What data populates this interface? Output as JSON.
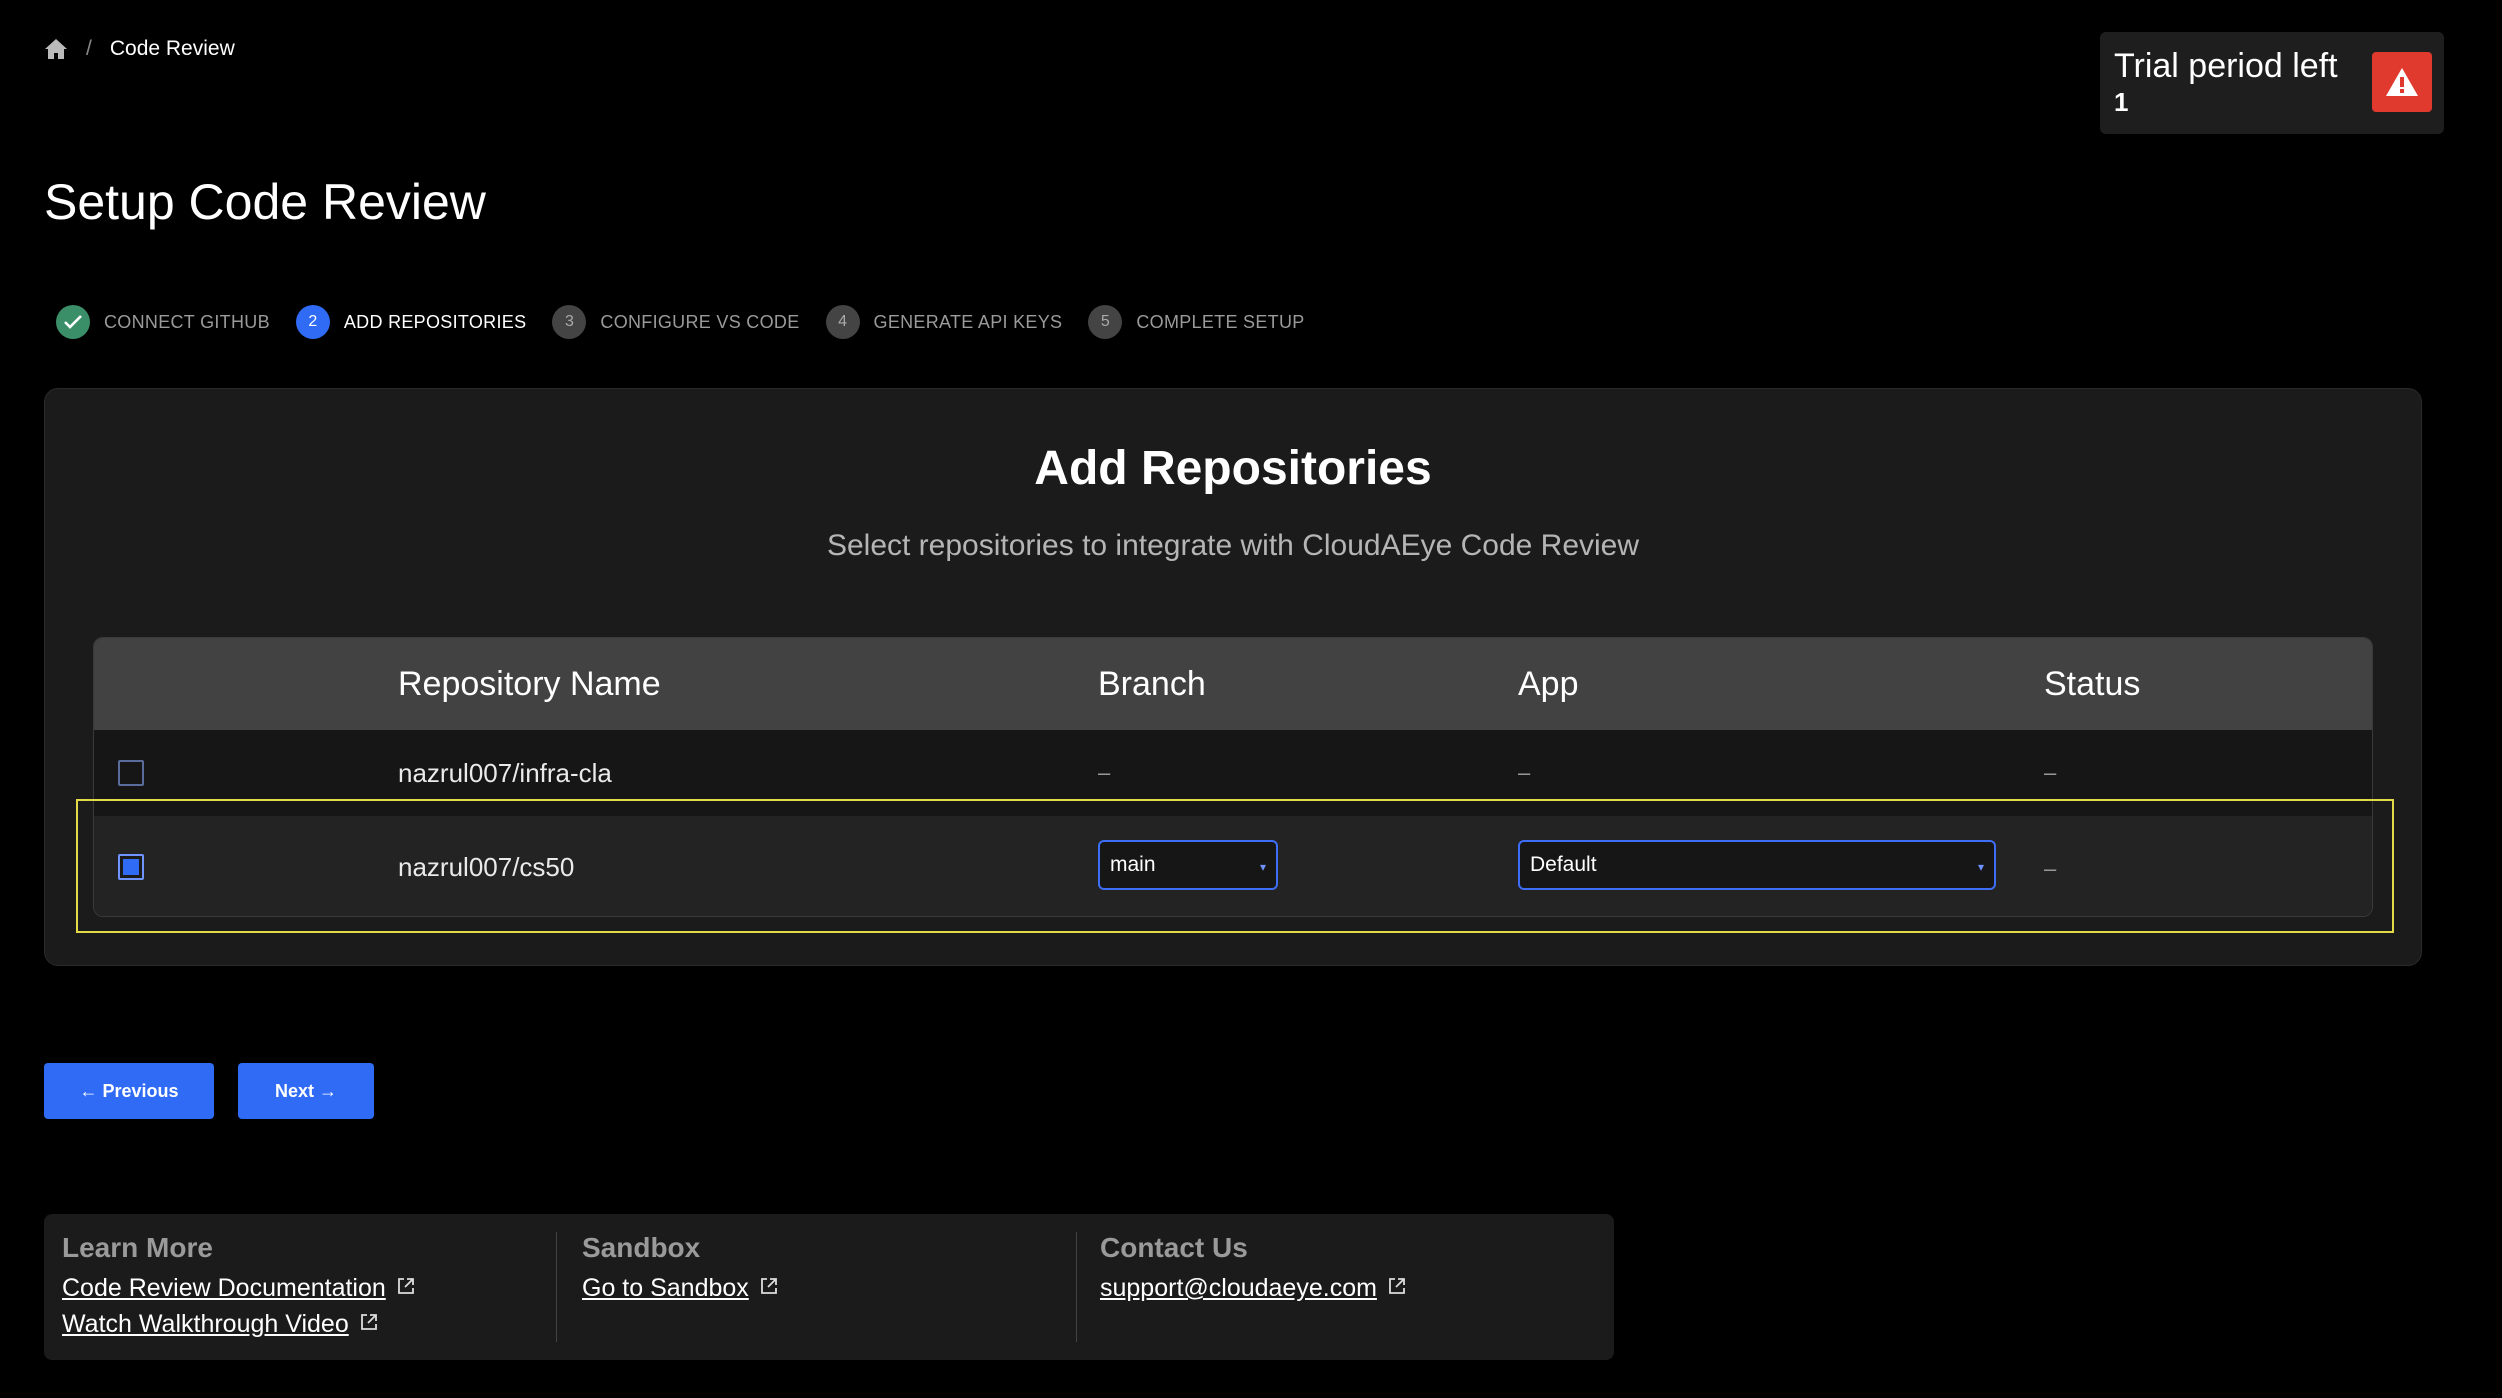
{
  "breadcrumb": {
    "home_icon": "home-icon",
    "separator": "/",
    "current": "Code Review"
  },
  "trial": {
    "label": "Trial period left",
    "count": "1",
    "icon": "warning-icon"
  },
  "page_title": "Setup Code Review",
  "steps": [
    {
      "num": "",
      "label": "CONNECT GITHUB",
      "state": "done"
    },
    {
      "num": "2",
      "label": "ADD REPOSITORIES",
      "state": "active"
    },
    {
      "num": "3",
      "label": "CONFIGURE VS CODE",
      "state": "pending"
    },
    {
      "num": "4",
      "label": "GENERATE API KEYS",
      "state": "pending"
    },
    {
      "num": "5",
      "label": "COMPLETE SETUP",
      "state": "pending"
    }
  ],
  "card": {
    "title": "Add Repositories",
    "subtitle": "Select repositories to integrate with CloudAEye Code Review"
  },
  "table": {
    "headers": [
      "Repository Name",
      "Branch",
      "App",
      "Status"
    ],
    "rows": [
      {
        "checked": false,
        "repo": "nazrul007/infra-cla",
        "branch": "–",
        "app": "–",
        "status": "–"
      },
      {
        "checked": true,
        "repo": "nazrul007/cs50",
        "branch": "main",
        "app": "Default",
        "status": "–"
      }
    ]
  },
  "buttons": {
    "previous": "← Previous",
    "next": "Next →"
  },
  "footer": {
    "learn_more": {
      "heading": "Learn More",
      "links": [
        "Code Review Documentation",
        "Watch Walkthrough Video"
      ]
    },
    "sandbox": {
      "heading": "Sandbox",
      "links": [
        "Go to Sandbox"
      ]
    },
    "contact": {
      "heading": "Contact Us",
      "links": [
        "support@cloudaeye.com"
      ]
    }
  },
  "colors": {
    "accent": "#2f6bf5",
    "done": "#3b8f68",
    "alert": "#e03a2f",
    "highlight": "#e3da47"
  }
}
